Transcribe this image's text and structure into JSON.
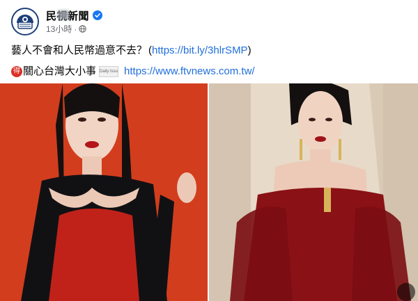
{
  "post": {
    "page_name": "民視新聞",
    "time": "13小時",
    "dot": "·",
    "text_line1": "藝人不會和人民幣過意不去？",
    "link1_open": "(",
    "link1": "https://bit.ly/3hlrSMP",
    "link1_close": ")",
    "badge": "得",
    "text_line2": "關心台灣大小事",
    "mini_logo": "Daily Issue",
    "link2": "https://www.ftvnews.com.tw/"
  },
  "icons": {
    "avatar": "ftv-logo-icon",
    "verified": "verified-badge-icon",
    "privacy": "globe-icon",
    "more": "more-photos-icon"
  },
  "colors": {
    "link": "#216fdb",
    "verified": "#1877f2",
    "left_photo_bg": "#d8421f",
    "right_photo_bg": "#e5d8c6"
  }
}
